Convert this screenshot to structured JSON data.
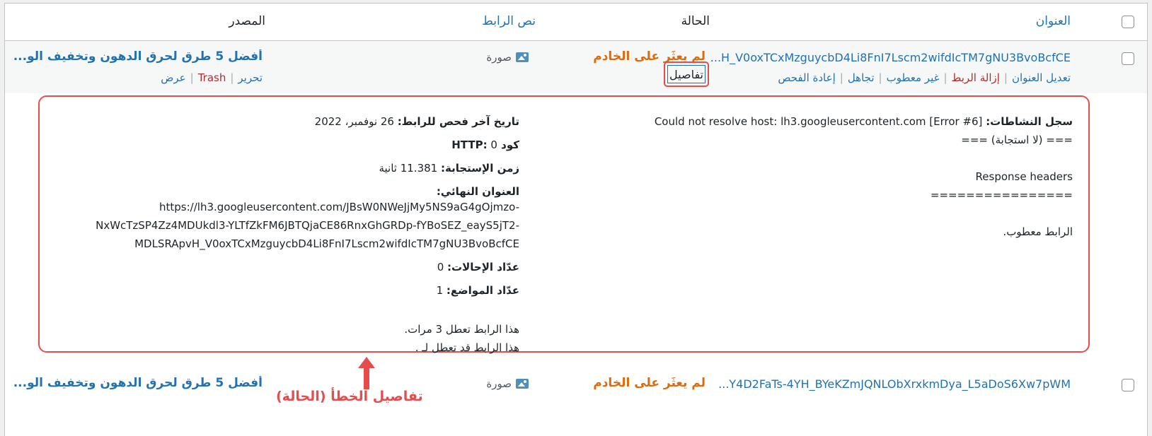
{
  "header": {
    "address": "العنوان",
    "status": "الحالة",
    "link_text": "نص الرابط",
    "source": "المصدر"
  },
  "row1": {
    "url": "...H_V0oxTCxMzguycbD4Li8FnI7Lscm2wifdIcTM7gNU3BvoBcfCE",
    "status": "لم يعثَر على الخادم",
    "details": "تفاصيل",
    "link_text": "صورة",
    "source": "أفضل 5 طرق لحرق الدهون وتخفيف الو...",
    "actions": [
      "تعديل العنوان",
      "إزالة الربط",
      "غير معطوب",
      "تجاهل",
      "إعادة الفحص"
    ],
    "source_actions": [
      "تحرير",
      "Trash",
      "عرض"
    ]
  },
  "details": {
    "log_label": "سجل النشاطات:",
    "log_value": "Could not resolve host: lh3.googleusercontent.com [Error #6]",
    "no_response": "=== (لا استجابة) ===",
    "response_headers": "Response headers",
    "separator": "================",
    "broken": "الرابط معطوب.",
    "last_check_label": "تاريخ آخر فحص للرابط:",
    "last_check_value": "26 نوفمبر، 2022",
    "http_label": "كود HTTP:",
    "http_value": "0",
    "response_time_label": "زمن الإستجابة:",
    "response_time_value": "11.381 ثانية",
    "final_url_label": "العنوان النهائي:",
    "final_url_lines": [
      "https://lh3.googleusercontent.com/JBsW0NWeJjMy5NS9aG4gOjmzo-",
      "NxWcTzSP4Zz4MDUkdl3-YLTfZkFM6JBTQjaCE86RnxGhGRDp-fYBoSEZ_eayS5jT2-",
      "MDLSRApvH_V0oxTCxMzguycbD4Li8FnI7Lscm2wifdIcTM7gNU3BvoBcfCE"
    ],
    "redirects_label": "عدّاد الإحالات:",
    "redirects_value": "0",
    "instances_label": "عدّاد المواضع:",
    "instances_value": "1",
    "note1": "هذا الرابط تعطل 3 مرات.",
    "note2": "هذا الرابط قد تعطل لـ ."
  },
  "row2": {
    "url": "...Y4D2FaTs-4YH_BYeKZmJQNLObXrxkmDya_L5aDoS6Xw7pWM",
    "status": "لم يعثَر على الخادم",
    "link_text": "صورة",
    "source": "أفضل 5 طرق لحرق الدهون وتخفيف الو..."
  },
  "annotation": "تفاصيل الخطأ (الحالة)",
  "colors": {
    "link": "#2271b1",
    "status": "#dd6a0c",
    "danger": "#b32d2e",
    "annotation": "#e74c4c"
  }
}
